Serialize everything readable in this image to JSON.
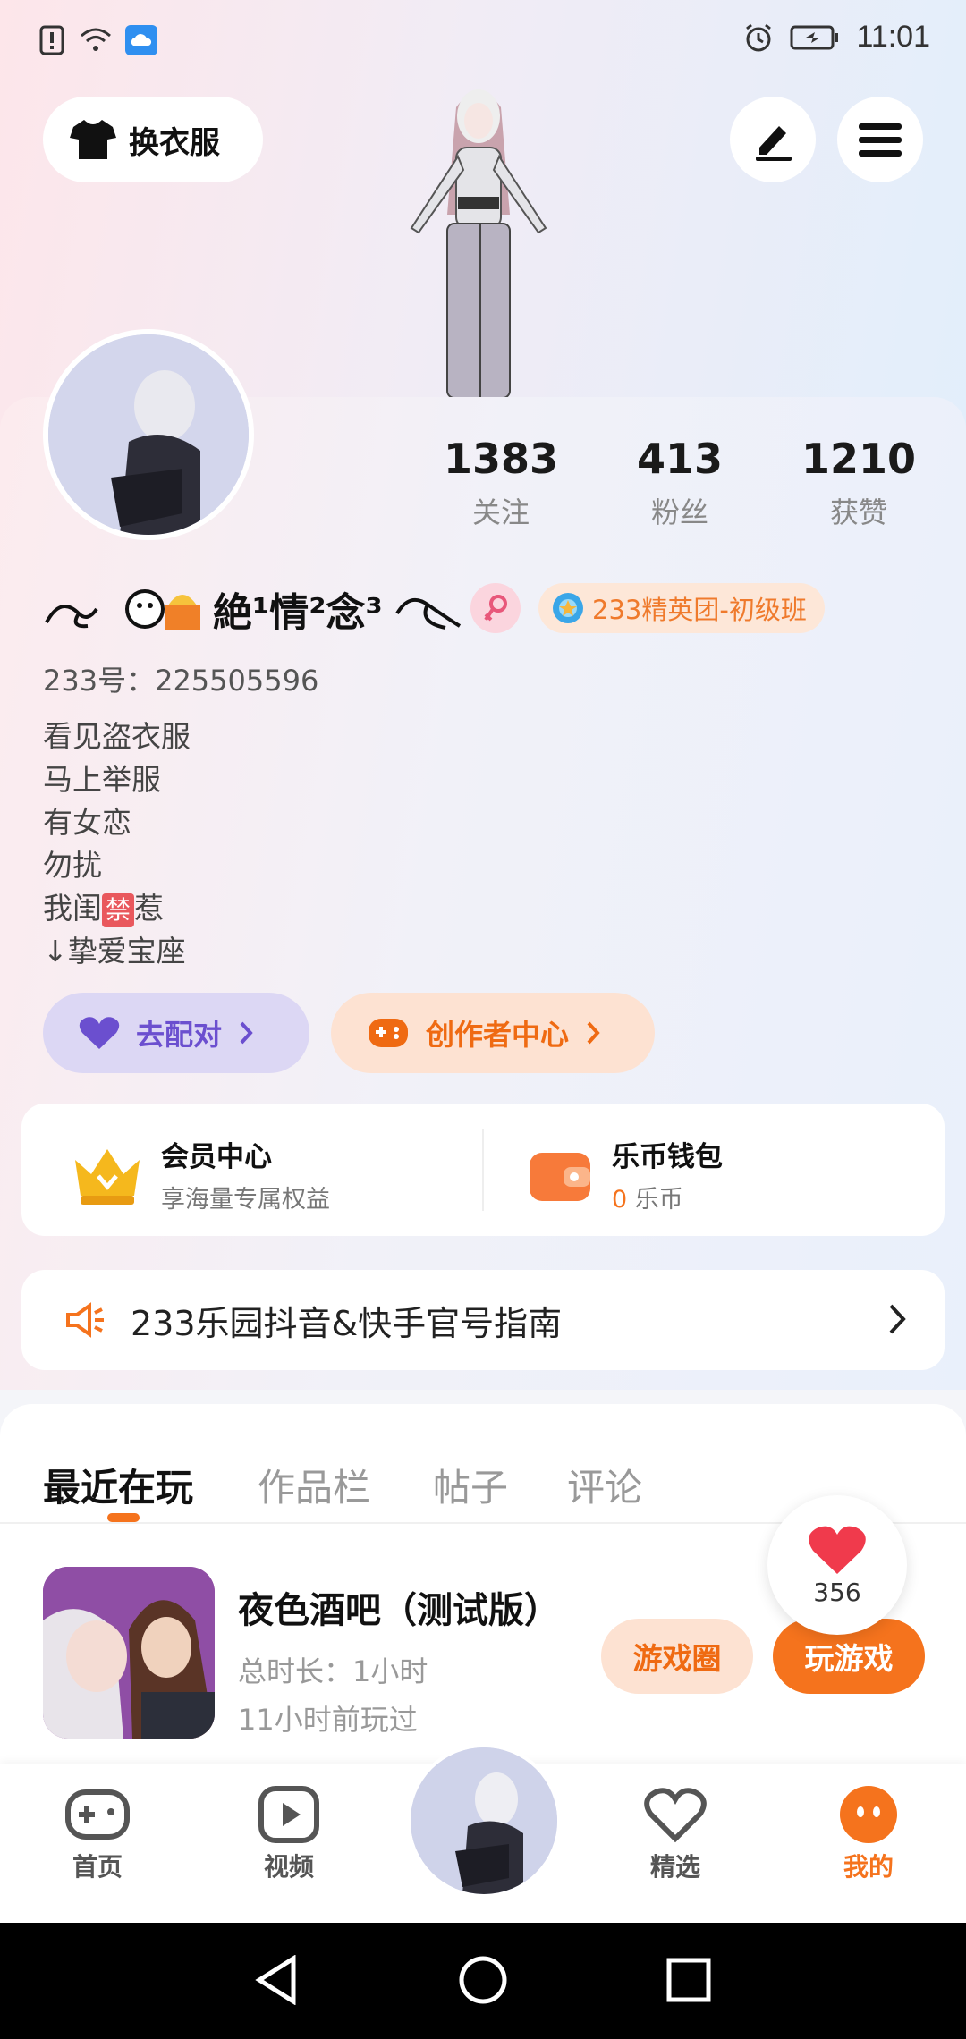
{
  "status_bar": {
    "time": "11:01"
  },
  "header": {
    "outfit_label": "换衣服"
  },
  "profile": {
    "stats": [
      {
        "value": "1383",
        "label": "关注"
      },
      {
        "value": "413",
        "label": "粉丝"
      },
      {
        "value": "1210",
        "label": "获赞"
      }
    ],
    "nickname": "絶¹情²念³",
    "title_badge": "233精英团-初级班",
    "user_id": "233号：225505596",
    "bio": [
      "看见盗衣服",
      "马上举服",
      "有女恋",
      "勿扰",
      "我闺",
      "惹",
      "↓挚爱宝座"
    ],
    "bio_ban": "禁",
    "match_button": "去配对",
    "creator_button": "创作者中心"
  },
  "wallet": {
    "vip_title": "会员中心",
    "vip_sub": "享海量专属权益",
    "coin_title": "乐币钱包",
    "coin_amount": "0",
    "coin_unit": "乐币"
  },
  "notice": {
    "text": "233乐园抖音&快手官号指南"
  },
  "tabs": [
    "最近在玩",
    "作品栏",
    "帖子",
    "评论"
  ],
  "recent_game": {
    "title": "夜色酒吧（测试版）",
    "duration": "总时长：1小时",
    "last_played": "11小时前玩过",
    "circle_button": "游戏圈",
    "play_button": "玩游戏"
  },
  "like_count": "356",
  "bottom_nav": [
    "首页",
    "视频",
    "精选",
    "我的"
  ],
  "colors": {
    "accent": "#f5731d",
    "match_purple": "#6b4fcf"
  }
}
